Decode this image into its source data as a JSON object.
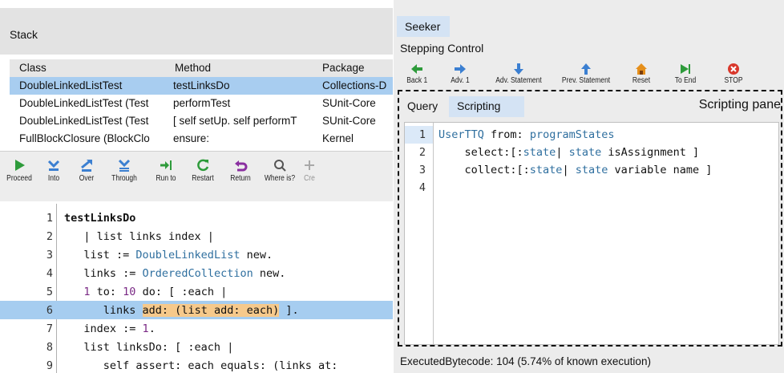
{
  "stack": {
    "title": "Stack",
    "columns": [
      "Class",
      "Method",
      "Package"
    ],
    "rows": [
      {
        "class": "DoubleLinkedListTest",
        "method": "testLinksDo",
        "package": "Collections-D"
      },
      {
        "class": "DoubleLinkedListTest (Test",
        "method": "performTest",
        "package": "SUnit-Core"
      },
      {
        "class": "DoubleLinkedListTest (Test",
        "method": "[  self setUp.  self performT",
        "package": "SUnit-Core"
      },
      {
        "class": "FullBlockClosure (BlockClo",
        "method": "ensure:",
        "package": "Kernel"
      }
    ]
  },
  "debugger_toolbar": [
    {
      "label": "Proceed",
      "icon": "proceed-icon"
    },
    {
      "label": "Into",
      "icon": "step-into-icon"
    },
    {
      "label": "Over",
      "icon": "step-over-icon"
    },
    {
      "label": "Through",
      "icon": "step-through-icon"
    },
    {
      "label": "Run to",
      "icon": "run-to-icon"
    },
    {
      "label": "Restart",
      "icon": "restart-icon"
    },
    {
      "label": "Return",
      "icon": "return-icon"
    },
    {
      "label": "Where is?",
      "icon": "magnifier-icon"
    },
    {
      "label": "Cre",
      "icon": "create-icon"
    }
  ],
  "code": {
    "lines": [
      "1",
      "2",
      "3",
      "4",
      "5",
      "6",
      "7",
      "8",
      "9"
    ]
  },
  "seeker": {
    "tab": "Seeker",
    "stepping_control": "Stepping Control",
    "buttons": [
      {
        "label": "Back 1",
        "icon": "back-arrow-icon"
      },
      {
        "label": "Adv. 1",
        "icon": "forward-arrow-icon"
      },
      {
        "label": "Adv. Statement",
        "icon": "down-arrow-icon"
      },
      {
        "label": "Prev. Statement",
        "icon": "up-arrow-icon"
      },
      {
        "label": "Reset",
        "icon": "home-icon"
      },
      {
        "label": "To End",
        "icon": "to-end-icon"
      },
      {
        "label": "STOP",
        "icon": "stop-icon"
      }
    ],
    "tabs": [
      "Query",
      "Scripting"
    ],
    "pane_label": "Scripting pane",
    "status": "ExecutedBytecode: 104 (5.74% of known execution)"
  },
  "colors": {
    "selection": "#a8cdf0",
    "code_highlight": "#f6c98b",
    "keyword": "#2f6f9f",
    "number": "#7a2a85",
    "tab_active": "#d4e3f4",
    "green_icon": "#2e9b3b",
    "blue_icon": "#3b7fd1",
    "stop_red": "#d9382c"
  }
}
